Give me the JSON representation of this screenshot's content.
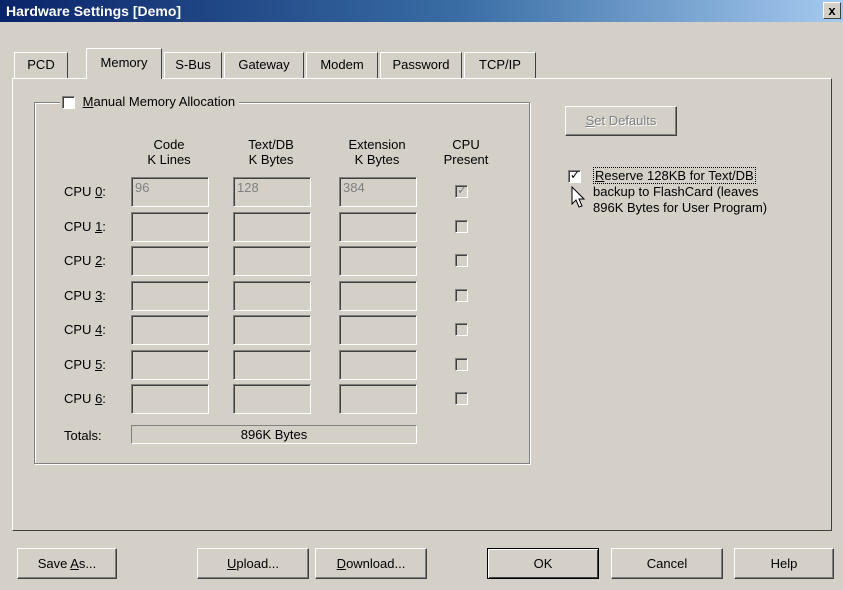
{
  "window": {
    "title": "Hardware Settings [Demo]",
    "close_glyph": "x"
  },
  "tabs": [
    {
      "label": "PCD",
      "active": false
    },
    {
      "label": "Memory",
      "active": true
    },
    {
      "label": "S-Bus",
      "active": false
    },
    {
      "label": "Gateway",
      "active": false
    },
    {
      "label": "Modem",
      "active": false
    },
    {
      "label": "Password",
      "active": false
    },
    {
      "label": "TCP/IP",
      "active": false
    }
  ],
  "memory": {
    "manual_allocation": {
      "label_accel": "M",
      "label_rest": "anual Memory Allocation",
      "checked": false
    },
    "columns": {
      "code": {
        "line1": "Code",
        "line2": "K Lines"
      },
      "textdb": {
        "line1": "Text/DB",
        "line2": "K Bytes"
      },
      "extension": {
        "line1": "Extension",
        "line2": "K Bytes"
      },
      "present": {
        "line1": "CPU",
        "line2": "Present"
      }
    },
    "cpus": [
      {
        "prefix": "CPU ",
        "accel": "0",
        "suffix": ":",
        "code": "96",
        "textdb": "128",
        "extension": "384",
        "present": true
      },
      {
        "prefix": "CPU ",
        "accel": "1",
        "suffix": ":",
        "code": "",
        "textdb": "",
        "extension": "",
        "present": false
      },
      {
        "prefix": "CPU ",
        "accel": "2",
        "suffix": ":",
        "code": "",
        "textdb": "",
        "extension": "",
        "present": false
      },
      {
        "prefix": "CPU ",
        "accel": "3",
        "suffix": ":",
        "code": "",
        "textdb": "",
        "extension": "",
        "present": false
      },
      {
        "prefix": "CPU ",
        "accel": "4",
        "suffix": ":",
        "code": "",
        "textdb": "",
        "extension": "",
        "present": false
      },
      {
        "prefix": "CPU ",
        "accel": "5",
        "suffix": ":",
        "code": "",
        "textdb": "",
        "extension": "",
        "present": false
      },
      {
        "prefix": "CPU ",
        "accel": "6",
        "suffix": ":",
        "code": "",
        "textdb": "",
        "extension": "",
        "present": false
      }
    ],
    "totals_label": "Totals:",
    "totals_value": "896K Bytes",
    "set_defaults": {
      "accel": "S",
      "rest": "et Defaults"
    },
    "reserve": {
      "checked": true,
      "accel": "R",
      "line1_rest": "eserve 128KB for Text/DB",
      "line2": "backup to FlashCard (leaves",
      "line3": "896K Bytes for User Program)"
    }
  },
  "buttons": {
    "save_as": {
      "before": "Save ",
      "accel": "A",
      "after": "s..."
    },
    "upload": {
      "before": "",
      "accel": "U",
      "after": "pload..."
    },
    "download": {
      "before": "",
      "accel": "D",
      "after": "ownload..."
    },
    "ok": "OK",
    "cancel": "Cancel",
    "help": "Help"
  }
}
